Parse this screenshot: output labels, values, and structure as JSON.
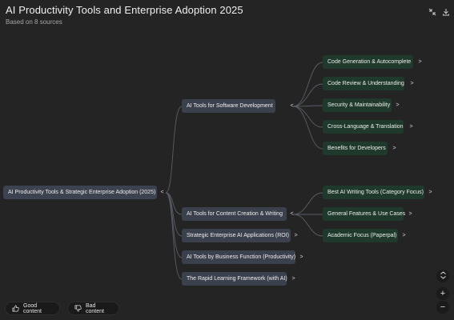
{
  "header": {
    "title": "AI Productivity Tools and Enterprise Adoption 2025",
    "subtitle": "Based on 8 sources",
    "collapse_icon": "collapse-arrows-icon",
    "download_icon": "download-icon"
  },
  "mindmap": {
    "root": {
      "label": "AI Productivity Tools & Strategic Enterprise Adoption (2025)",
      "toggle": "<"
    },
    "branches": [
      {
        "label": "AI Tools for Software Development",
        "toggle": "<"
      },
      {
        "label": "AI Tools for Content Creation & Writing",
        "toggle": "<"
      },
      {
        "label": "Strategic Enterprise AI Applications (ROI)",
        "toggle": ">"
      },
      {
        "label": "AI Tools by Business Function (Productivity)",
        "toggle": ">"
      },
      {
        "label": "The Rapid Learning Framework (with AI)",
        "toggle": ">"
      }
    ],
    "software_leaves": [
      {
        "label": "Code Generation & Autocomplete",
        "toggle": ">"
      },
      {
        "label": "Code Review & Understanding",
        "toggle": ">"
      },
      {
        "label": "Security & Maintainability",
        "toggle": ">"
      },
      {
        "label": "Cross-Language & Translation",
        "toggle": ">"
      },
      {
        "label": "Benefits for Developers",
        "toggle": ">"
      }
    ],
    "content_leaves": [
      {
        "label": "Best AI Writing Tools (Category Focus)",
        "toggle": ">"
      },
      {
        "label": "General Features & Use Cases",
        "toggle": ">"
      },
      {
        "label": "Academic Focus (Paperpal)",
        "toggle": ">"
      }
    ]
  },
  "feedback": {
    "good_label": "Good content",
    "bad_label": "Bad content",
    "good_icon": "thumbs-up-icon",
    "bad_icon": "thumbs-down-icon"
  },
  "zoom": {
    "fit_icon": "expand-vertical-icon",
    "zoom_in_label": "+",
    "zoom_out_label": "−"
  },
  "colors": {
    "background": "#242424",
    "root_node": "#3d4250",
    "branch_node": "#3b404d",
    "leaf_node": "#1f3a2c",
    "connector": "#5a5e66"
  }
}
